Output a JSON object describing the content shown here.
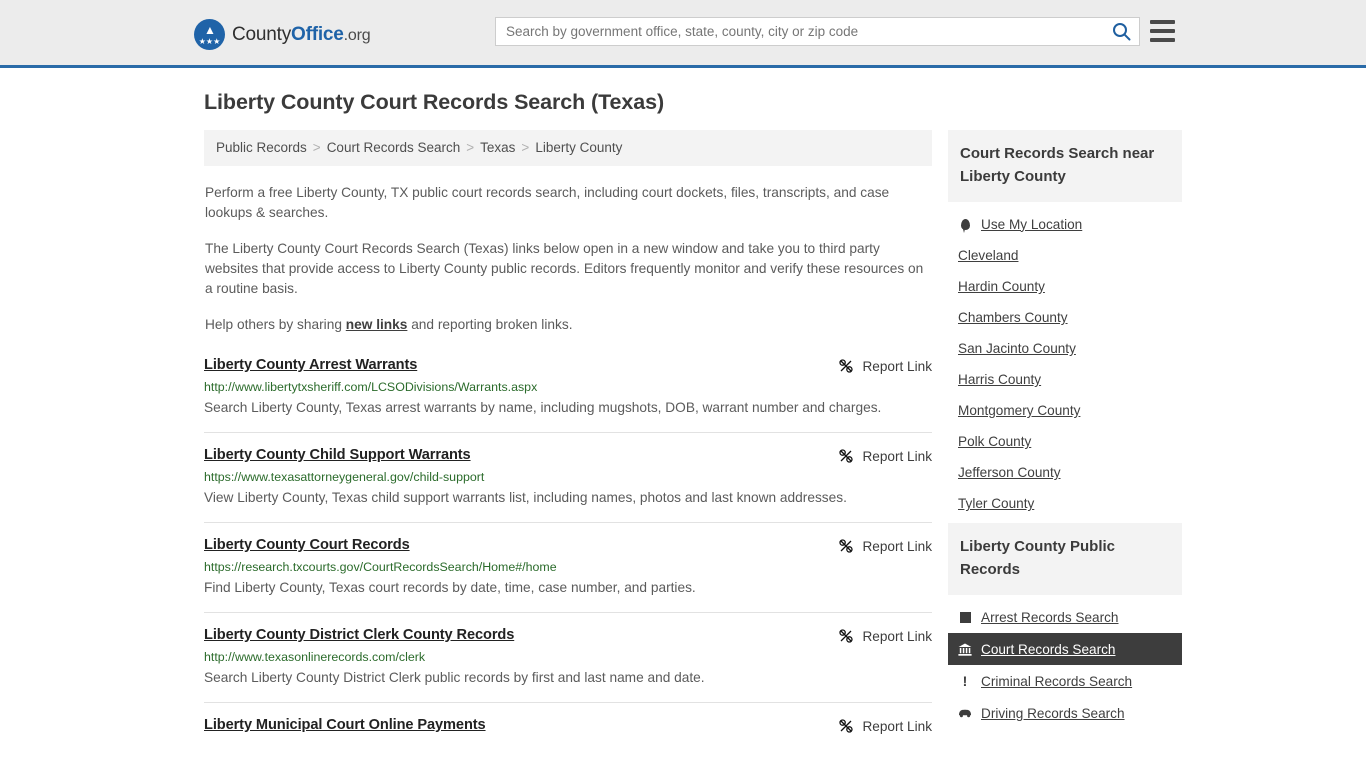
{
  "header": {
    "brand": {
      "part1": "County",
      "part2": "Office",
      "part3": ".org"
    },
    "search": {
      "placeholder": "Search by government office, state, county, city or zip code",
      "value": ""
    }
  },
  "page": {
    "title": "Liberty County Court Records Search (Texas)"
  },
  "breadcrumb": [
    "Public Records",
    "Court Records Search",
    "Texas",
    "Liberty County"
  ],
  "breadcrumb_separator": ">",
  "intro": {
    "p1": "Perform a free Liberty County, TX public court records search, including court dockets, files, transcripts, and case lookups & searches.",
    "p2": "The Liberty County Court Records Search (Texas) links below open in a new window and take you to third party websites that provide access to Liberty County public records. Editors frequently monitor and verify these resources on a routine basis.",
    "p3_before": "Help others by sharing ",
    "p3_link": "new links",
    "p3_after": " and reporting broken links."
  },
  "report_link_label": "Report Link",
  "results": [
    {
      "title": "Liberty County Arrest Warrants",
      "url": "http://www.libertytxsheriff.com/LCSODivisions/Warrants.aspx",
      "description": "Search Liberty County, Texas arrest warrants by name, including mugshots, DOB, warrant number and charges."
    },
    {
      "title": "Liberty County Child Support Warrants",
      "url": "https://www.texasattorneygeneral.gov/child-support",
      "description": "View Liberty County, Texas child support warrants list, including names, photos and last known addresses."
    },
    {
      "title": "Liberty County Court Records",
      "url": "https://research.txcourts.gov/CourtRecordsSearch/Home#/home",
      "description": "Find Liberty County, Texas court records by date, time, case number, and parties."
    },
    {
      "title": "Liberty County District Clerk County Records",
      "url": "http://www.texasonlinerecords.com/clerk",
      "description": "Search Liberty County District Clerk public records by first and last name and date."
    },
    {
      "title": "Liberty Municipal Court Online Payments",
      "url": "",
      "description": ""
    }
  ],
  "sidebar": {
    "near_card": {
      "heading": "Court Records Search near Liberty County",
      "items": [
        {
          "label": "Use My Location",
          "icon": "map-pin-icon"
        },
        {
          "label": "Cleveland",
          "icon": ""
        },
        {
          "label": "Hardin County",
          "icon": ""
        },
        {
          "label": "Chambers County",
          "icon": ""
        },
        {
          "label": "San Jacinto County",
          "icon": ""
        },
        {
          "label": "Harris County",
          "icon": ""
        },
        {
          "label": "Montgomery County",
          "icon": ""
        },
        {
          "label": "Polk County",
          "icon": ""
        },
        {
          "label": "Jefferson County",
          "icon": ""
        },
        {
          "label": "Tyler County",
          "icon": ""
        }
      ]
    },
    "public_records_card": {
      "heading": "Liberty County Public Records",
      "items": [
        {
          "label": "Arrest Records Search",
          "icon": "square-icon",
          "active": false
        },
        {
          "label": "Court Records Search",
          "icon": "courthouse-icon",
          "active": true
        },
        {
          "label": "Criminal Records Search",
          "icon": "exclamation-icon",
          "active": false
        },
        {
          "label": "Driving Records Search",
          "icon": "car-icon",
          "active": false
        }
      ]
    }
  },
  "colors": {
    "header_bg": "#ececec",
    "header_border": "#2a6ba8",
    "brand_blue": "#1f63a8",
    "url_green": "#2b6b2b",
    "panel_bg": "#f3f3f3",
    "active_bg": "#3d3d3d"
  }
}
